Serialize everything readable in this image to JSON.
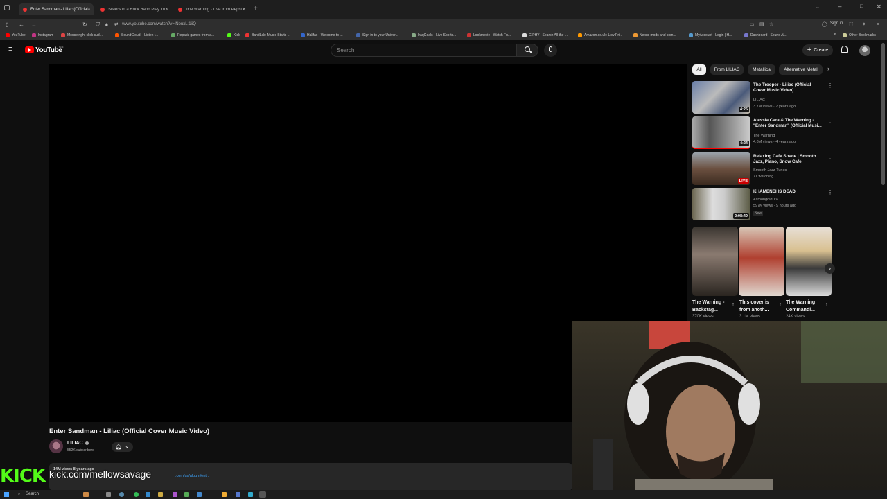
{
  "browser": {
    "tabs": [
      {
        "label": "Enter Sandman - Liliac (Official",
        "active": true
      },
      {
        "label": "Sisters in a Rock Band Play Truth",
        "active": false
      },
      {
        "label": "The Warning - Live from Pepsi C",
        "active": false
      }
    ],
    "new_tab": "+",
    "url": "www.youtube.com/watch?v=iNouxLI1iiQ",
    "sign_in": "Sign in",
    "bookmarks": [
      "YouTube",
      "Instagram",
      "Mouse right click sud...",
      "SoundCloud – Listen t...",
      "Repack games from a...",
      "Kick",
      "BandLab: Music Starts ...",
      "Halifax - Welcome to ...",
      "Sign in to your Univer...",
      "IraqGoals - Live Sports...",
      "Lookmovie - Watch Fu...",
      "GIPHY | Search All the ...",
      "Amazon.co.uk: Low Pri...",
      "Nexus mods and com...",
      "MyAccount - Login | H...",
      "Dashboard | Sound Al..."
    ],
    "other_bookmarks": "Other Bookmarks"
  },
  "youtube": {
    "logo_text": "YouTube",
    "logo_region": "GB",
    "search_placeholder": "Search",
    "create_label": "Create",
    "video_title": "Enter Sandman - Liliac (Official Cover Music Video)",
    "channel": {
      "name": "LILIAC",
      "subscribers": "552K subscribers"
    },
    "description": {
      "stats": "14M views  8 years ago",
      "link_text": ".com/us/album/ent..."
    },
    "chips": [
      "All",
      "From LILIAC",
      "Metallica",
      "Alternative Metal"
    ],
    "recommendations": [
      {
        "title": "The Trooper - Liliac (Official Cover Music Video)",
        "channel": "LILIAC",
        "meta": "3.7M views · 7 years ago",
        "duration": "4:25"
      },
      {
        "title": "Alessia Cara & The Warning - \"Enter Sandman\" (Official Musi...",
        "channel": "The Warning",
        "meta": "4.8M views · 4 years ago",
        "duration": "4:24"
      },
      {
        "title": "Relaxing Cafe Space | Smooth Jazz, Piano, Snow Cafe",
        "channel": "Smooth Jazz Tunes",
        "meta": "71 watching",
        "duration": "LIVE"
      },
      {
        "title": "KHAMENEI IS DEAD",
        "channel": "Asmongold TV",
        "meta": "597K views · 9 hours ago",
        "badge": "New",
        "duration": "2:08:49"
      }
    ],
    "shorts": [
      {
        "title": "The Warning - Backstag...",
        "views": "370K views"
      },
      {
        "title": "This cover is from anoth...",
        "views": "3.1M views"
      },
      {
        "title": "The Warning Commandi...",
        "views": "24K views"
      }
    ]
  },
  "overlay": {
    "kick_logo": "KICK",
    "kick_url": "kick.com/mellowsavage"
  },
  "taskbar": {
    "search": "Search"
  },
  "colors": {
    "kick_green": "#53fc18",
    "yt_red": "#ff0000",
    "bg": "#0f0f0f"
  }
}
